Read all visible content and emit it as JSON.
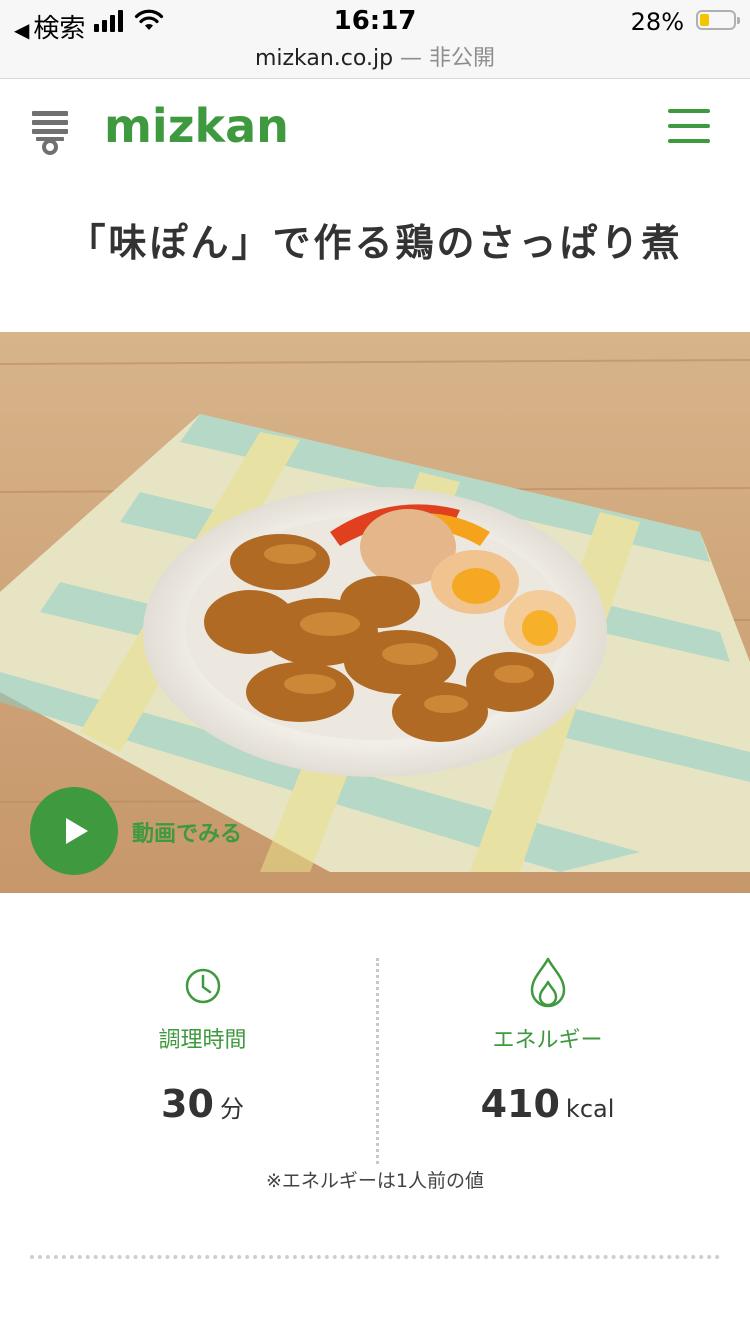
{
  "status_bar": {
    "back_label": "検索",
    "time": "16:17",
    "battery_percent": "28%",
    "battery_level": 0.28
  },
  "url_bar": {
    "domain": "mizkan.co.jp",
    "separator": " — ",
    "privacy": "非公開"
  },
  "header": {
    "logo_text": "mizkan",
    "brand_color": "#3f9a3f"
  },
  "recipe": {
    "title": "「味ぽん」で作る鶏のさっぱり煮",
    "video_label": "動画でみる"
  },
  "info": {
    "cook_time": {
      "label": "調理時間",
      "value": "30",
      "unit": "分",
      "icon": "clock-icon"
    },
    "energy": {
      "label": "エネルギー",
      "value": "410",
      "unit": "kcal",
      "icon": "flame-icon"
    },
    "note": "※エネルギーは1人前の値"
  }
}
